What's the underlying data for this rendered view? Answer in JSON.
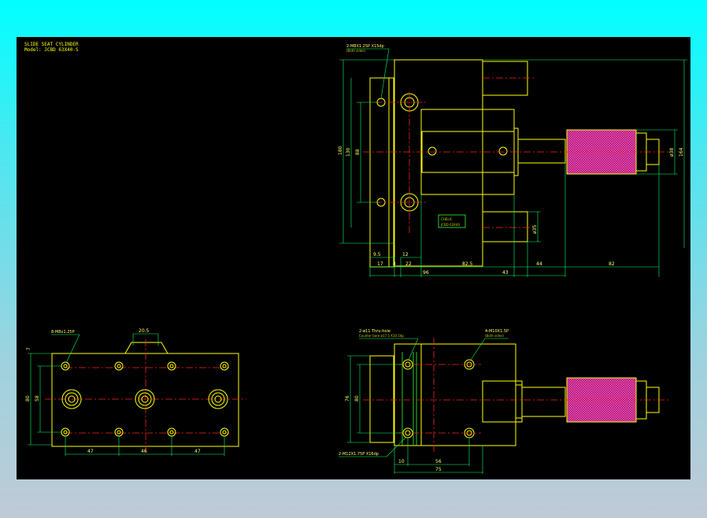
{
  "title": {
    "line1": "SLIDE SEAT CYLINDER",
    "line2": "Model: JCBD 63X40-S"
  },
  "top_view": {
    "callout_tap": "2-M8X1.25P X15dp",
    "callout_tap_sub": "(Both sides)",
    "dim_v_left_1": "180",
    "dim_v_left_2": "130",
    "dim_v_left_3": "88",
    "dim_v_right_1": "ø38",
    "dim_v_right_2": "164",
    "dim_v_small": "ø35",
    "dim_h": [
      "9.5",
      "17",
      "4",
      "12",
      "22",
      "82.5",
      "43",
      "44",
      "82",
      "96"
    ],
    "label_plate": "CHELIC",
    "label_plate_sub": "JCBD 63X40"
  },
  "bottom_left_view": {
    "callout": "8-M8x1.25P",
    "dim_top": "20.5",
    "dim_left_outer": "80",
    "dim_left_inner": "58",
    "dim_top_small": "7",
    "dim_bottom": [
      "47",
      "46",
      "47"
    ]
  },
  "bottom_right_view": {
    "callout_left": "2-ø11 Thru-hole",
    "callout_left_sub": "Counter bore ø17.5 X10.5dp",
    "callout_right": "4-M10X1.5P",
    "callout_right_sub": "(Both sides)",
    "callout_bottom": "2-M12X1.75P X16dp",
    "dim_left_1": "76",
    "dim_left_2": "80",
    "dim_bottom": [
      "10",
      "56",
      "75"
    ]
  },
  "colors": {
    "background_gradient_top": "#00ffff",
    "background_gradient_bottom": "#bfcad6",
    "sheet": "#000000",
    "outline": "#ffff00",
    "hidden": "#33ff33",
    "centerline": "#ff2222",
    "dimension": "#00ff66",
    "knurl": "#c0207f"
  }
}
